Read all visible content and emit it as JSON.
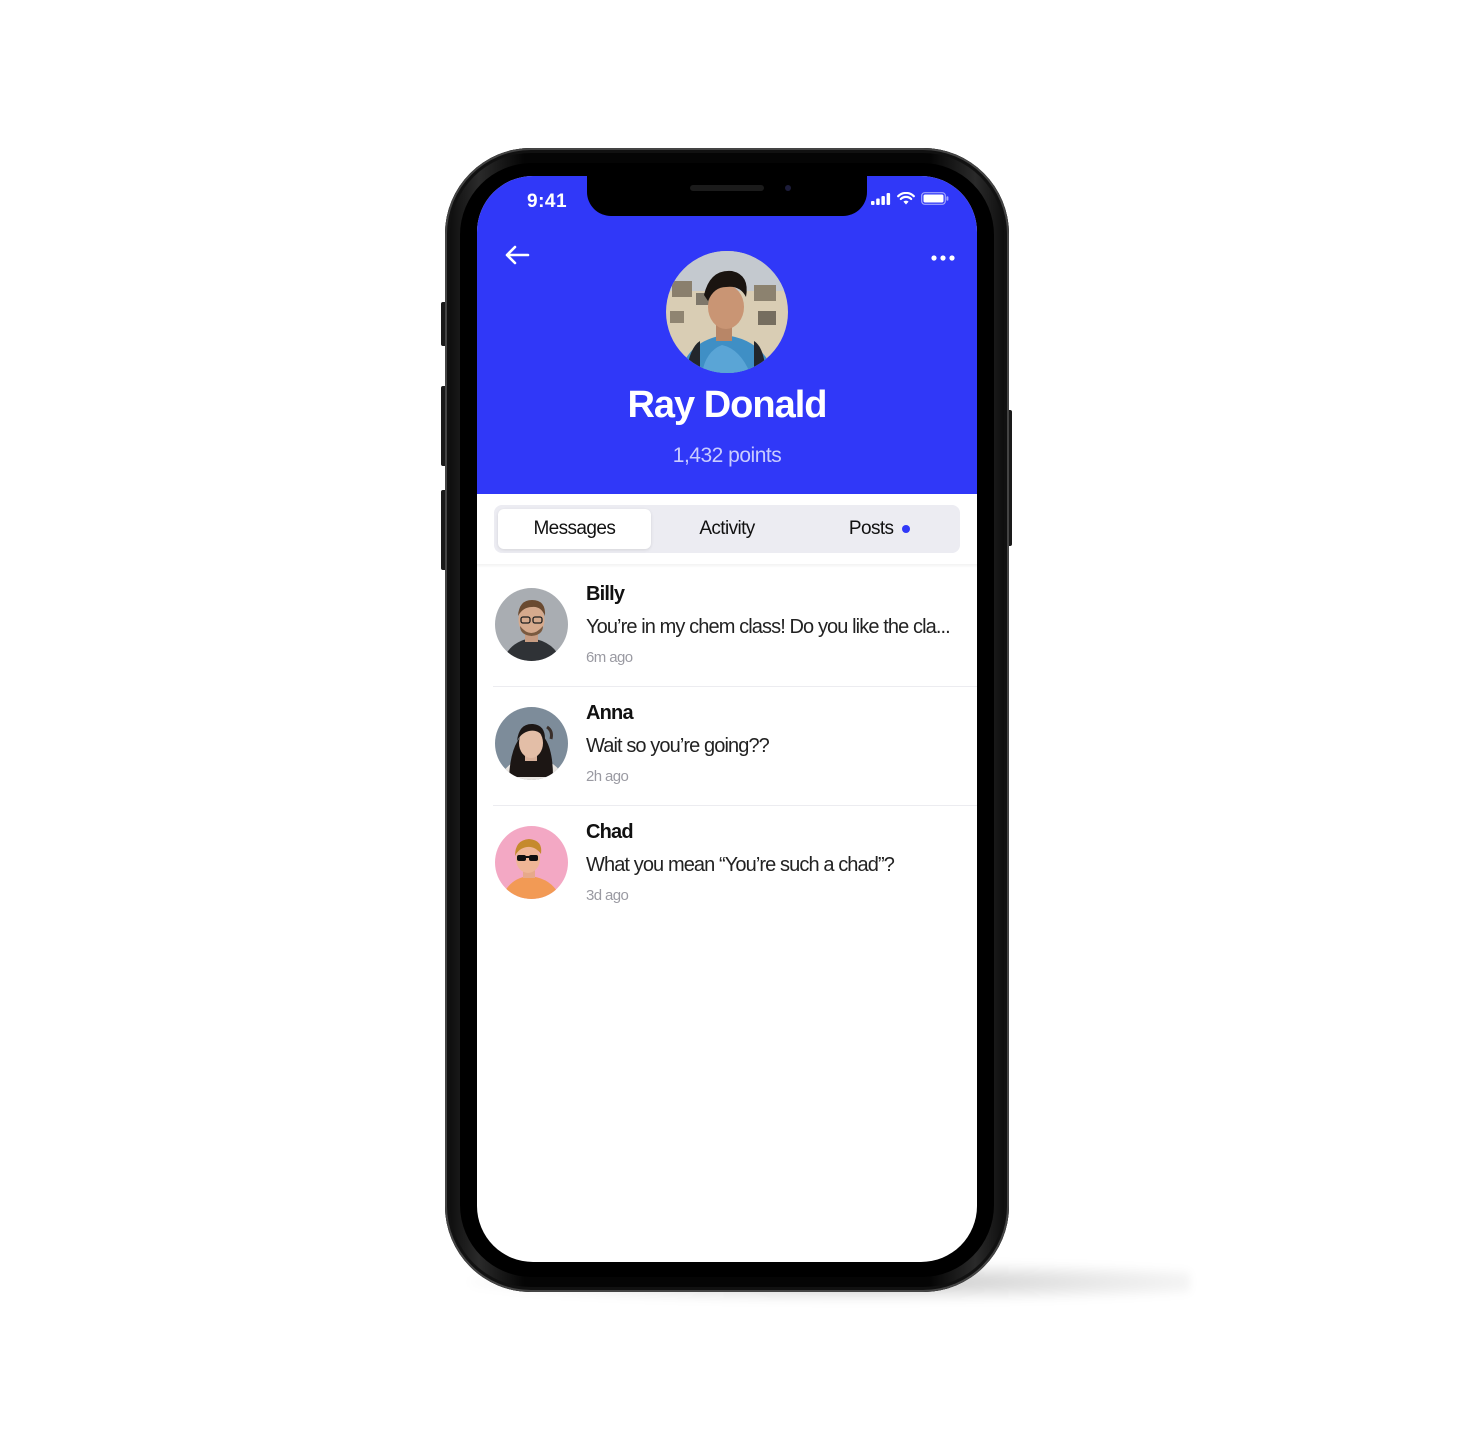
{
  "status_bar": {
    "time": "9:41",
    "icons": [
      "signal-icon",
      "wifi-icon",
      "battery-icon"
    ]
  },
  "header": {
    "back_icon": "arrow-left-icon",
    "more_icon": "more-horizontal-icon",
    "background_color": "#3038f8"
  },
  "profile": {
    "name": "Ray Donald",
    "points": "1,432 points"
  },
  "tabs": [
    {
      "label": "Messages",
      "active": true
    },
    {
      "label": "Activity",
      "active": false
    },
    {
      "label": "Posts",
      "active": false,
      "has_notification_dot": true
    }
  ],
  "messages": [
    {
      "name": "Billy",
      "preview": "You’re in my chem class! Do you like the cla...",
      "time": "6m ago"
    },
    {
      "name": "Anna",
      "preview": "Wait so you’re going??",
      "time": "2h ago"
    },
    {
      "name": "Chad",
      "preview": "What you mean “You’re such a chad”?",
      "time": "3d ago"
    }
  ],
  "colors": {
    "accent": "#3038f8",
    "tab_background": "#ececf2",
    "timestamp": "#9a9aa2"
  }
}
